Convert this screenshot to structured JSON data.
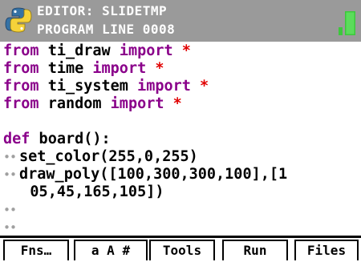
{
  "header": {
    "title": "EDITOR: SLIDETMP",
    "subtitle": "PROGRAM LINE 0008",
    "logo_icon": "python-logo-icon",
    "battery_icon": "battery-icon",
    "bg_color": "#9a9a9a",
    "battery_color": "#3cc83c"
  },
  "editor": {
    "keyword_color": "#8a008a",
    "star_color": "#e10000",
    "lines": [
      {
        "kw": "from",
        "text": " ti_draw ",
        "kw2": "import",
        "star": " *"
      },
      {
        "kw": "from",
        "text": " time ",
        "kw2": "import",
        "star": " *"
      },
      {
        "kw": "from",
        "text": " ti_system ",
        "kw2": "import",
        "star": " *"
      },
      {
        "kw": "from",
        "text": " random ",
        "kw2": "import",
        "star": " *"
      },
      {
        "text": ""
      },
      {
        "kw": "def",
        "text": " board():"
      },
      {
        "indent": "••",
        "text": "set_color(255,0,255)"
      },
      {
        "indent": "••",
        "text": "draw_poly([100,300,300,100],[1"
      },
      {
        "text": "   05,45,165,105])"
      },
      {
        "indent": "••",
        "text": ""
      },
      {
        "indent": "••",
        "text": ""
      }
    ]
  },
  "menu": {
    "fns": "Fns…",
    "chars": "a A #",
    "tools": "Tools",
    "run": "Run",
    "files": "Files"
  }
}
